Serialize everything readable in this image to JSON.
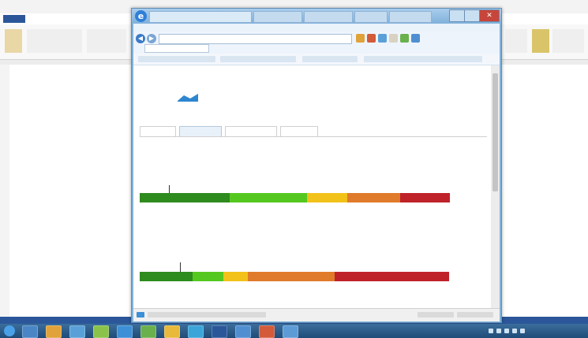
{
  "word": {
    "tabs": [
      "",
      "",
      "",
      "",
      "",
      ""
    ]
  },
  "browser": {
    "title": "",
    "address": "",
    "favorites": [
      "",
      "",
      "",
      ""
    ],
    "status": [
      "",
      "",
      ""
    ]
  },
  "page": {
    "login_link": "",
    "logo": {
      "line1": "",
      "line2": "",
      "colors": {
        "line1": "#e87a2a",
        "line2": "#2d86cf"
      }
    },
    "tabs": [
      "",
      "",
      "",
      ""
    ],
    "active_tab_index": 1,
    "intro": "",
    "sections": [
      {
        "title": "",
        "description": "",
        "marker_label": "",
        "ticks": [
          "",
          "",
          "",
          "",
          "",
          "",
          ""
        ],
        "note": "",
        "segments": [
          {
            "color": "#2e8b1e",
            "share": 0.29
          },
          {
            "color": "#55c81f",
            "share": 0.25
          },
          {
            "color": "#f2c21a",
            "share": 0.06
          },
          {
            "color": "#f2c21a",
            "share": 0.07
          },
          {
            "color": "#e07b2c",
            "share": 0.17
          },
          {
            "color": "#c0222a",
            "share": 0.16
          }
        ],
        "marker_position": 0.095
      },
      {
        "title": "",
        "description": "",
        "marker_label": "",
        "ticks": [
          "",
          "",
          "",
          "",
          "",
          "",
          ""
        ],
        "note": "",
        "segments": [
          {
            "color": "#2e8b1e",
            "share": 0.17
          },
          {
            "color": "#55c81f",
            "share": 0.1
          },
          {
            "color": "#f2c21a",
            "share": 0.08
          },
          {
            "color": "#e07b2c",
            "share": 0.28
          },
          {
            "color": "#c0222a",
            "share": 0.37
          }
        ],
        "marker_position": 0.13
      }
    ]
  },
  "taskbar": {
    "clock": "",
    "apps": [
      {
        "icon": "explorer-icon",
        "color": "#4a86c5"
      },
      {
        "icon": "media-player-icon",
        "color": "#e0a23a"
      },
      {
        "icon": "network-icon",
        "color": "#5aa0d8"
      },
      {
        "icon": "app-icon",
        "color": "#8bc34a"
      },
      {
        "icon": "browser-icon",
        "color": "#3d8fd6"
      },
      {
        "icon": "app-icon",
        "color": "#6ab04c"
      },
      {
        "icon": "folder-icon",
        "color": "#e8b93a"
      },
      {
        "icon": "app-icon",
        "color": "#3aa5d9"
      },
      {
        "icon": "word-icon",
        "color": "#2b579a"
      },
      {
        "icon": "app-icon",
        "color": "#4f8fd1"
      },
      {
        "icon": "app-icon",
        "color": "#d35b3a"
      },
      {
        "icon": "app-icon",
        "color": "#5c9bd6"
      }
    ]
  }
}
